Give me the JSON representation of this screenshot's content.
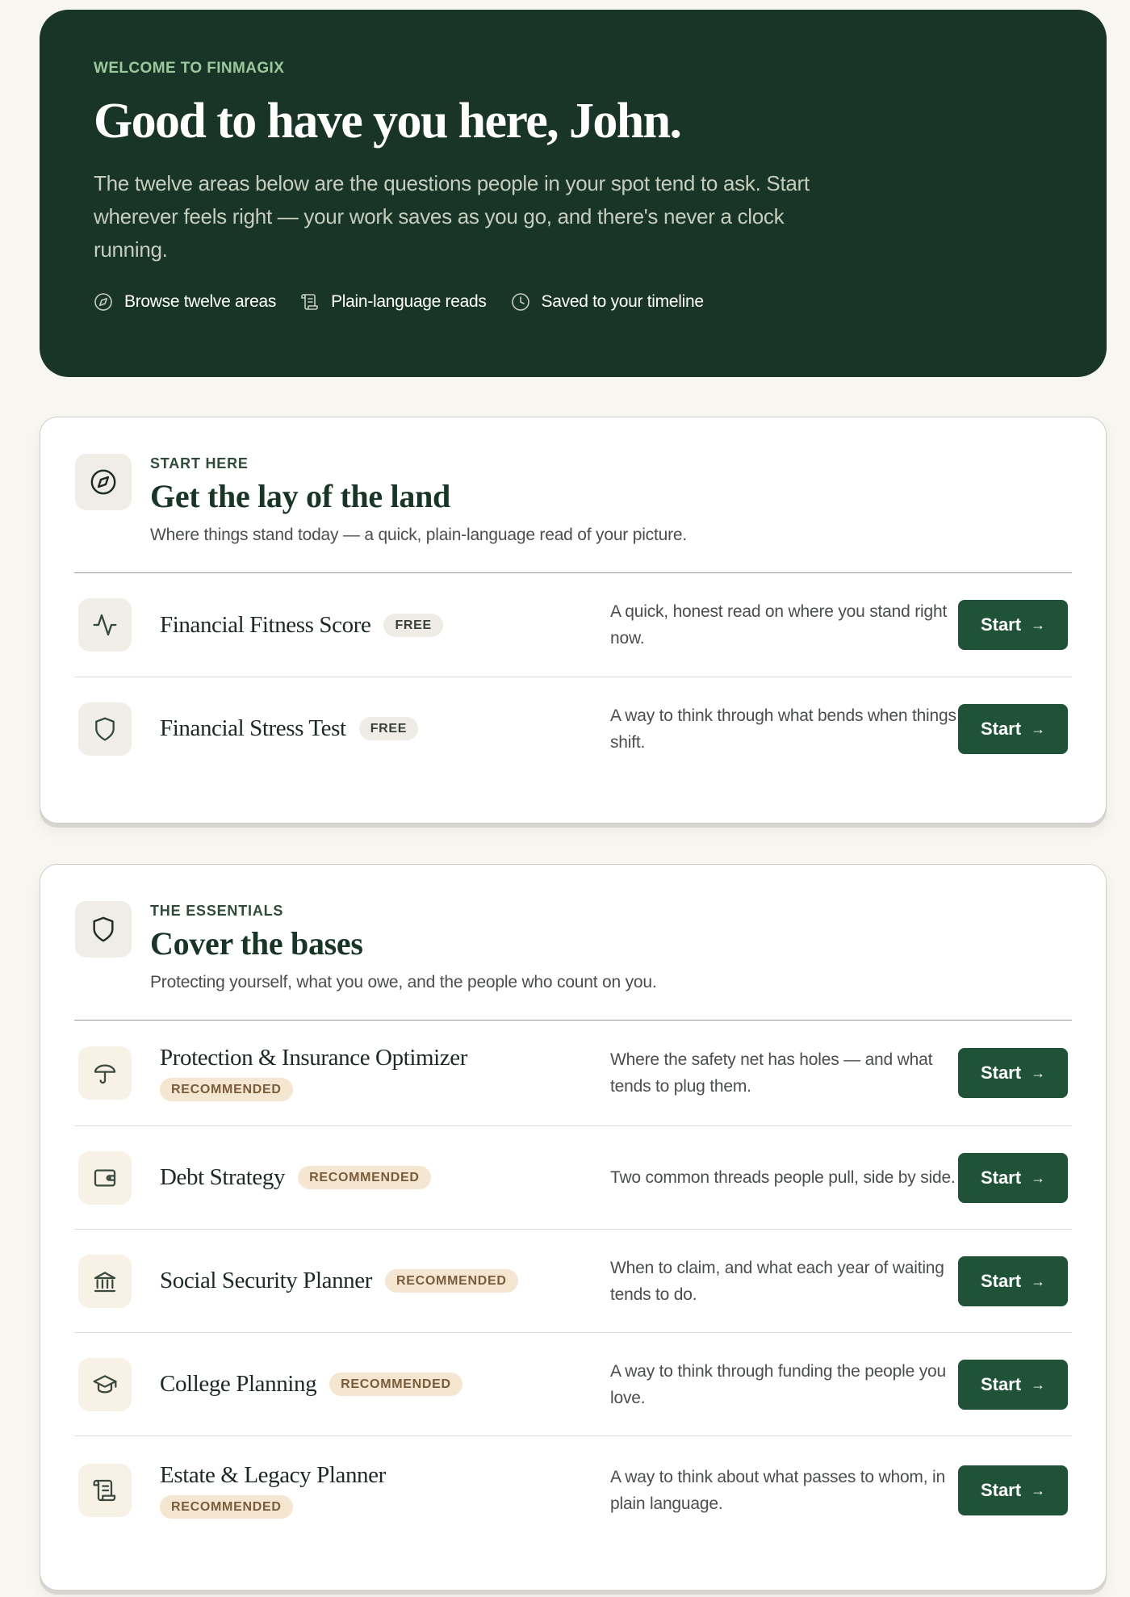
{
  "hero": {
    "eyebrow": "WELCOME TO FINMAGIX",
    "title": "Good to have you here, John.",
    "body": "The twelve areas below are the questions people in your spot tend to ask. Start wherever feels right — your work saves as you go, and there's never a clock running.",
    "chips": [
      {
        "icon": "compass-icon",
        "label": "Browse twelve areas"
      },
      {
        "icon": "scroll-icon",
        "label": "Plain-language reads"
      },
      {
        "icon": "clock-icon",
        "label": "Saved to your timeline"
      }
    ]
  },
  "sections": [
    {
      "icon": "compass-icon",
      "eyebrow": "START HERE",
      "title": "Get the lay of the land",
      "subtitle": "Where things stand today — a quick, plain-language read of your picture.",
      "rows": [
        {
          "icon": "pulse-icon",
          "title": "Financial Fitness Score",
          "badge": "FREE",
          "description": "A quick, honest read on where you stand right now.",
          "button": "Start"
        },
        {
          "icon": "shield-icon",
          "title": "Financial Stress Test",
          "badge": "FREE",
          "description": "A way to think through what bends when things shift.",
          "button": "Start"
        }
      ]
    },
    {
      "icon": "shield-icon",
      "eyebrow": "THE ESSENTIALS",
      "title": "Cover the bases",
      "subtitle": "Protecting yourself, what you owe, and the people who count on you.",
      "rows": [
        {
          "icon": "umbrella-icon",
          "title": "Protection & Insurance Optimizer",
          "badge": "RECOMMENDED",
          "description": "Where the safety net has holes — and what tends to plug them.",
          "button": "Start"
        },
        {
          "icon": "wallet-icon",
          "title": "Debt Strategy",
          "badge": "RECOMMENDED",
          "description": "Two common threads people pull, side by side.",
          "button": "Start"
        },
        {
          "icon": "bank-icon",
          "title": "Social Security Planner",
          "badge": "RECOMMENDED",
          "description": "When to claim, and what each year of waiting tends to do.",
          "button": "Start"
        },
        {
          "icon": "graduation-cap-icon",
          "title": "College Planning",
          "badge": "RECOMMENDED",
          "description": "A way to think through funding the people you love.",
          "button": "Start"
        },
        {
          "icon": "scroll-icon",
          "title": "Estate & Legacy Planner",
          "badge": "RECOMMENDED",
          "description": "A way to think about what passes to whom, in plain language.",
          "button": "Start"
        }
      ]
    }
  ]
}
